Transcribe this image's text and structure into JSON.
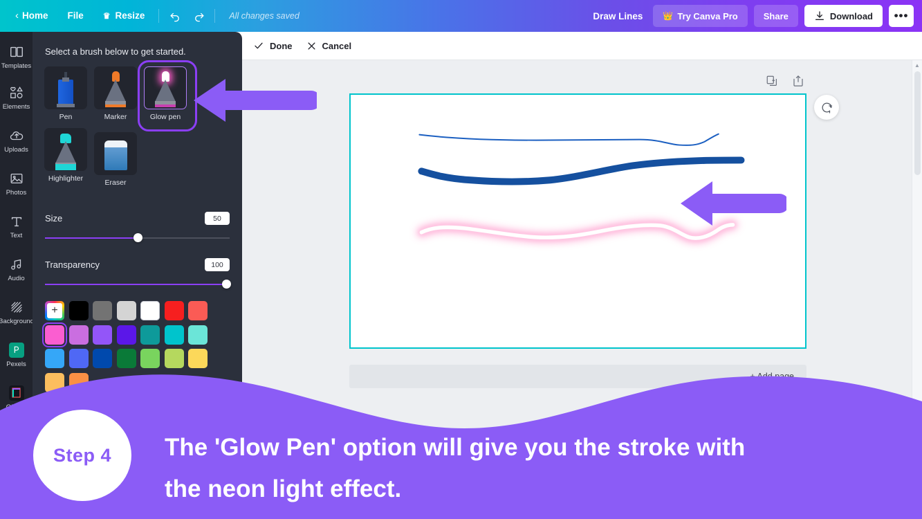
{
  "topbar": {
    "back_icon": "chevron-left-icon",
    "home": "Home",
    "file": "File",
    "resize": "Resize",
    "resize_icon": "crown-icon",
    "undo_icon": "undo-icon",
    "redo_icon": "redo-icon",
    "status": "All changes saved",
    "doc_title": "Draw Lines",
    "try_pro": "Try Canva Pro",
    "try_pro_icon": "crown-icon",
    "share": "Share",
    "download": "Download",
    "download_icon": "download-icon",
    "more": "•••",
    "gradient_start": "#00c4cc",
    "gradient_end": "#8b33f5"
  },
  "rail": {
    "items": [
      {
        "label": "Templates",
        "icon": "templates-icon"
      },
      {
        "label": "Elements",
        "icon": "elements-icon"
      },
      {
        "label": "Uploads",
        "icon": "upload-cloud-icon"
      },
      {
        "label": "Photos",
        "icon": "photo-icon"
      },
      {
        "label": "Text",
        "icon": "text-icon"
      },
      {
        "label": "Audio",
        "icon": "audio-note-icon"
      },
      {
        "label": "Background",
        "icon": "background-hatch-icon"
      },
      {
        "label": "Pexels",
        "icon": "pexels-icon"
      },
      {
        "label": "GIPHY",
        "icon": "giphy-icon"
      }
    ]
  },
  "panel": {
    "title": "Select a brush below to get started.",
    "brushes": [
      {
        "name": "Pen",
        "selected": false
      },
      {
        "name": "Marker",
        "selected": false
      },
      {
        "name": "Glow pen",
        "selected": true
      },
      {
        "name": "Highlighter",
        "selected": false
      },
      {
        "name": "Eraser",
        "selected": false
      }
    ],
    "size": {
      "label": "Size",
      "value": "50",
      "percent": 50
    },
    "transparency": {
      "label": "Transparency",
      "value": "100",
      "percent": 100
    },
    "accent": "#8b3ff5",
    "swatches": [
      {
        "color": "add",
        "selected": false,
        "name": "add-color"
      },
      {
        "color": "#000000",
        "selected": false
      },
      {
        "color": "#737373",
        "selected": false
      },
      {
        "color": "#d4d4d4",
        "selected": false
      },
      {
        "color": "#ffffff",
        "selected": false
      },
      {
        "color": "#f61f1f",
        "selected": false
      },
      {
        "color": "#fb5b55",
        "selected": false
      },
      {
        "color": "#fa5ed0",
        "selected": true
      },
      {
        "color": "#ca6ee0",
        "selected": false
      },
      {
        "color": "#9355f9",
        "selected": false
      },
      {
        "color": "#5b17e8",
        "selected": false
      },
      {
        "color": "#0e9a9a",
        "selected": false
      },
      {
        "color": "#00c4cc",
        "selected": false
      },
      {
        "color": "#6be5d8",
        "selected": false
      },
      {
        "color": "#35a7f8",
        "selected": false
      },
      {
        "color": "#4f68f5",
        "selected": false
      },
      {
        "color": "#0049ad",
        "selected": false
      },
      {
        "color": "#0a7a38",
        "selected": false
      },
      {
        "color": "#79d45e",
        "selected": false
      },
      {
        "color": "#b5d85e",
        "selected": false
      },
      {
        "color": "#fcd85a",
        "selected": false
      },
      {
        "color": "#fcbe5e",
        "selected": false
      },
      {
        "color": "#fa9045",
        "selected": false
      }
    ],
    "collapse_icon": "chevron-left-icon"
  },
  "editor": {
    "done": "Done",
    "done_icon": "check-icon",
    "cancel": "Cancel",
    "cancel_icon": "x-icon",
    "duplicate_icon": "duplicate-page-icon",
    "addpage_icon": "add-page-icon",
    "comment_icon": "add-comment-icon",
    "add_page": "+ Add page",
    "canvas_border": "#00c4cc"
  },
  "canvas_strokes": [
    {
      "name": "thin-pen-stroke",
      "type": "pen",
      "color": "#1b5fc1",
      "width": 2
    },
    {
      "name": "thick-marker-stroke",
      "type": "marker",
      "color": "#15509f",
      "width": 9
    },
    {
      "name": "pink-glow-stroke",
      "type": "glow",
      "color": "#ffffff",
      "glow": "#ffaed4",
      "width": 7
    }
  ],
  "annotations": {
    "arrow_color": "#8b5cf6",
    "arrow_brush": "arrow-pointing-to-glow-pen",
    "arrow_canvas": "arrow-pointing-to-glow-stroke"
  },
  "overlay": {
    "wave_color": "#8b5cf6",
    "step_label": "Step 4",
    "caption_line1": "The 'Glow Pen' option will give you the stroke with",
    "caption_line2": "the neon light effect.",
    "step_text_color": "#8b5cf6"
  }
}
